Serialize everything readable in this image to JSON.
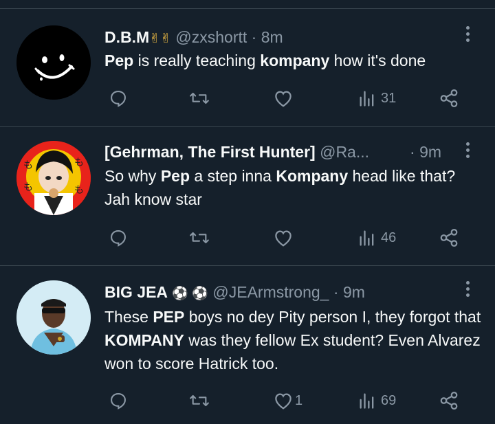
{
  "tweets": [
    {
      "name": "D.B.M",
      "badges": "✌✌",
      "handle": "@zxshortt",
      "time": "8m",
      "segments": [
        {
          "t": "Pep",
          "b": true
        },
        {
          "t": " is really teaching ",
          "b": false
        },
        {
          "t": "kompany",
          "b": true
        },
        {
          "t": " how it's done",
          "b": false
        }
      ],
      "reply_count": "",
      "retweet_count": "",
      "like_count": "",
      "views": "31",
      "avatar": "smiley-face"
    },
    {
      "name": "[Gehrman, The First Hunter]",
      "badges": "",
      "handle": "@Ra...",
      "time": "9m",
      "segments": [
        {
          "t": "So why ",
          "b": false
        },
        {
          "t": "Pep",
          "b": true
        },
        {
          "t": " a step inna ",
          "b": false
        },
        {
          "t": "Kompany",
          "b": true
        },
        {
          "t": " head like that? Jah know star",
          "b": false
        }
      ],
      "reply_count": "",
      "retweet_count": "",
      "like_count": "",
      "views": "46",
      "avatar": "anime-character"
    },
    {
      "name": "BIG JEA",
      "badges": "⚽ ⚽",
      "handle": "@JEArmstrong_",
      "time": "9m",
      "segments": [
        {
          "t": "These ",
          "b": false
        },
        {
          "t": "PEP",
          "b": true
        },
        {
          "t": " boys no dey Pity person I, they forgot that ",
          "b": false
        },
        {
          "t": "KOMPANY",
          "b": true
        },
        {
          "t": " was they fellow Ex student? Even Alvarez won to score Hatrick too.",
          "b": false
        }
      ],
      "reply_count": "",
      "retweet_count": "",
      "like_count": "1",
      "views": "69",
      "avatar": "person-photo"
    }
  ],
  "colors": {
    "background": "#15202b",
    "text": "#f7f9f9",
    "muted": "#8b98a5",
    "divider": "#38444d"
  }
}
